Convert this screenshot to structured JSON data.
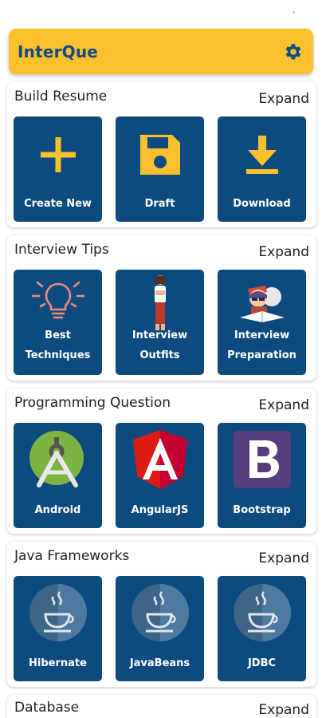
{
  "app": {
    "title": "InterQue",
    "settings_icon": "gear-icon",
    "accent": "#fbc02d",
    "tile_color": "#0d4a7f"
  },
  "sections": [
    {
      "title": "Build Resume",
      "expand": "Expand",
      "items": [
        {
          "label": "Create New",
          "icon": "plus-icon"
        },
        {
          "label": "Draft",
          "icon": "floppy-disk-icon"
        },
        {
          "label": "Download",
          "icon": "download-icon"
        }
      ]
    },
    {
      "title": "Interview Tips",
      "expand": "Expand",
      "items": [
        {
          "label1": "Best",
          "label2": "Techniques",
          "icon": "lightbulb-icon"
        },
        {
          "label1": "Interview",
          "label2": "Outfits",
          "icon": "woman-figure-icon"
        },
        {
          "label1": "Interview",
          "label2": "Preparation",
          "icon": "student-studying-icon"
        }
      ]
    },
    {
      "title": "Programming Question",
      "expand": "Expand",
      "items": [
        {
          "label": "Android",
          "icon": "android-icon"
        },
        {
          "label": "AngularJS",
          "icon": "angular-icon"
        },
        {
          "label": "Bootstrap",
          "icon": "bootstrap-icon"
        }
      ]
    },
    {
      "title": "Java Frameworks",
      "expand": "Expand",
      "items": [
        {
          "label": "Hibernate",
          "icon": "java-coffee-icon"
        },
        {
          "label": "JavaBeans",
          "icon": "java-coffee-icon"
        },
        {
          "label": "JDBC",
          "icon": "java-coffee-icon"
        }
      ]
    },
    {
      "title": "Database",
      "expand": "Expand"
    }
  ]
}
